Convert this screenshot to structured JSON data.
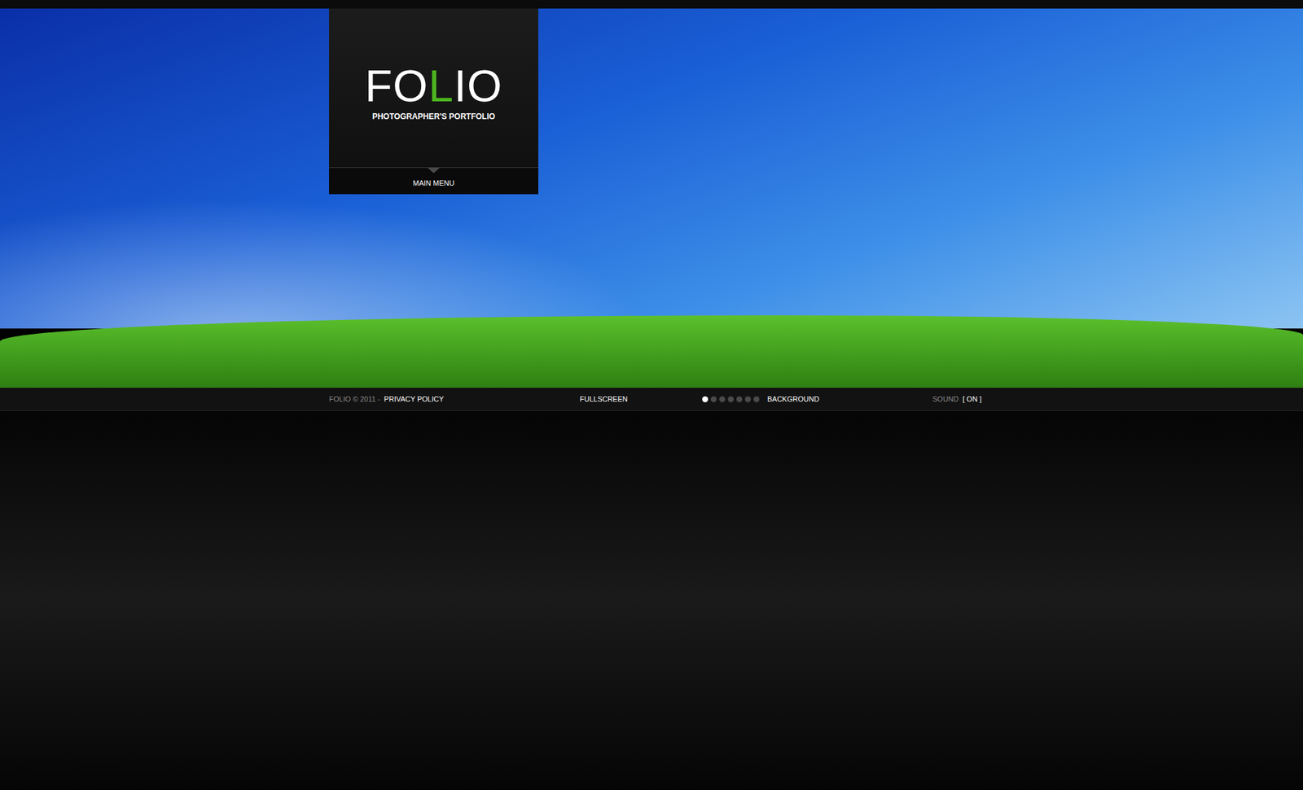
{
  "header": {
    "logo": [
      {
        "text": "FO",
        "accent": false
      },
      {
        "text": "L",
        "accent": true
      },
      {
        "text": "IO",
        "accent": false
      }
    ],
    "tagline": "PHOTOGRAPHER'S PORTFOLIO",
    "menu": "MAIN MENU"
  },
  "footer": {
    "copyright": "FOLIO © 2011 -",
    "privacy": "PRIVACY POLICY",
    "fullscreen": "FULLSCREEN",
    "background": {
      "label": "BACKGROUND",
      "slides": [
        {
          "selected": true
        },
        {
          "selected": false
        },
        {
          "selected": false
        },
        {
          "selected": false
        },
        {
          "selected": false
        },
        {
          "selected": false
        },
        {
          "selected": false
        }
      ]
    },
    "sound": {
      "label": "SOUND",
      "value": "[ ON ]",
      "on": true
    }
  }
}
